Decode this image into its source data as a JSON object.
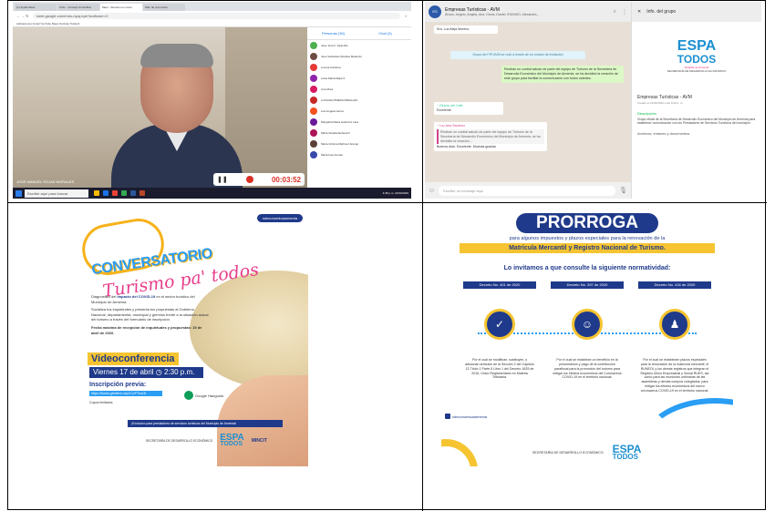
{
  "meet": {
    "tabs": [
      "(1) Ayuda Meet",
      "Ciclo · Consejo Consultivo",
      "Meet · Reunión en curso",
      "Plan de promoción"
    ],
    "url": "meet.google.com/mns-rqcq-tqm?authuser=0",
    "bookmarks": "Aplicaciones  Gmail  YouTube  Maps  Noticias  Traducir",
    "speaker_name": "JOSE MANUEL ROJAS MORALES",
    "timer": "00:03:52",
    "panel_tabs": [
      "Personas (30)",
      "Chat (3)"
    ],
    "participants": [
      "Jose Jose F. Jaramillo",
      "Juan Sebastian Morales Betancur",
      "Lorena Cardona",
      "Luisa Maria Mejia S",
      "Lina Mora",
      "LUCIANA PINEDA MIRALLES",
      "Luis Angela Carmo",
      "Margarita Maria Gutierrez Lara",
      "Maria Claudia Echeverri",
      "Maria Cristina Martinez Arango",
      "Maria Ines Acosta"
    ],
    "search_placeholder": "Escribe aquí para buscar",
    "clock": "4:38 p.m. 21/04/2020"
  },
  "whatsapp": {
    "group_name": "Empresas Turísticas - AVM",
    "members": "Álvaro, Angelo, Angela, Ana, Gloria, Daniel, IRUNIKO, Alexandra...",
    "msg1": "Sra. Luz Aleja Moreno",
    "msg2": "Grupo de FIP-AVM se unió a través de un enlace de invitación",
    "msg3": "Reciban un cordial saludo de parte del equipo de Turismo de la Secretaría de Desarrollo Económico del Municipio de Armenia, se ha decidido la creación de este grupo para facilitar la comunicación con todos ustedes.",
    "msg4_name": "~ Rincón del Café",
    "msg4_text": "Excelente",
    "msg5_name": "~ Luz Ana Sanchez",
    "msg5_quote": "Reciban un cordial saludo de parte del equipo de Turismo de la Secretaría de Desarrollo Económico del Municipio de Armenia, se ha decidido la creación...",
    "msg5_text": "Buenos días. Excelente. Muchas gracias",
    "input_placeholder": "Escribe un mensaje aquí",
    "info_header": "Info. del grupo",
    "logo_esp": "ESPA",
    "logo_todos": "TODOS",
    "logo_tag": "Alcaldía de Armenia",
    "logo_sec": "SECRETARÍA DE DESARROLLO ECONÓMICO",
    "info_name": "Empresas Turísticas - AVM",
    "info_created": "Creado el 21/04/2020 a las 9:49 a. m.",
    "desc_label": "Descripción",
    "desc_text": "Grupo oficial de la Secretaría de Desarrollo Económico del Municipio de Armenia para establecer comunicación con los Prestadores de Servicios Turísticos del municipio.",
    "files_label": "Archivos, enlaces y documentos"
  },
  "poster": {
    "handle": "sdeconomicaarmenia",
    "title1": "CONVERSATORIO",
    "title2": "Turismo pa' todos",
    "p1_pre": "Diagnóstico del ",
    "p1_bold": "impacto del COVID-19",
    "p1_post": " en el sector turístico del Municipio de Armenia.",
    "p2": "Socializa tus inquietudes y presenta tus propuestas al Gobierno Nacional, departamental, municipal y gremios frente a la situación actual del turismo a través del formulario de inscripción.",
    "p3": "Fecha máxima de recepción de inquietudes y propuestas: 15 de abril de 2020.",
    "videoconf": "Videoconferencia",
    "date": "Viernes 17 de abril  ◷ 2:30 p.m.",
    "insc_label": "Inscripción previa:",
    "insc_link": "https://forms.gle/kfmn-wjcCCzPTmn3t",
    "cupos": "Cupos limitados",
    "hangouts": "Google Hangouts",
    "exclusive": "¡Exclusivo para prestadores de servicios turísticos del Municipio de Armenia!",
    "sec": "SECRETARÍA DE DESARROLLO ECONÓMICO",
    "esp": "ESPA",
    "todos": "TODOS",
    "mincit": "MINCIT"
  },
  "prorroga": {
    "title": "PRORROGA",
    "sub": "para algunos impuestos y plazos especiales para la renovación de la",
    "band": "Matrícula Mercantil y Registro Nacional de Turismo.",
    "invite": "Lo invitamos a que consulte la siguiente normatividad:",
    "decrees": [
      {
        "name": "Decreto No. 401 de 2020",
        "text": "Por el cual se modifican, sustituyen, y adicionan artículos de la Sección 2 del Capítulo 13 Título 1 Parte 6 Libro 1 del Decreto 1625 de 2016, Único Reglamentario en Materia Tributaria.",
        "icon": "calendar-check-icon",
        "glyph": "✓"
      },
      {
        "name": "Decreto No. 397 de 2020",
        "text": "Por el cual se establece un beneficio en la presentación y pago de la contribución parafiscal para la promoción del turismo para mitigar los efectos económicos del Coronavirus COVID-19 en el territorio nacional.",
        "icon": "people-icon",
        "glyph": "☺"
      },
      {
        "name": "Decreto No. 434 de 2020",
        "text": "Por el cual se establecen plazos especiales para la renovación de la matrícula mercantil, el RUNEOL y los demás registros que integran el Registro Único Empresarial y Social RUES, así como para las reuniones ordinarias de las asambleas y demás cuerpos colegiados, para mitigar los efectos económicos del nuevo coronavirus COVID-19 en el territorio nacional.",
        "icon": "meeting-icon",
        "glyph": "♟"
      }
    ],
    "social": "sdeconomicaarmenia",
    "sec": "SECRETARÍA DE DESARROLLO ECONÓMICO",
    "esp": "ESPA",
    "todos": "TODOS"
  },
  "colors": {
    "navy": "#1f3a8a",
    "yellow": "#f6c431",
    "blue": "#2a9df4",
    "pink": "#e83e8c",
    "wa_green": "#dcf8c6"
  }
}
